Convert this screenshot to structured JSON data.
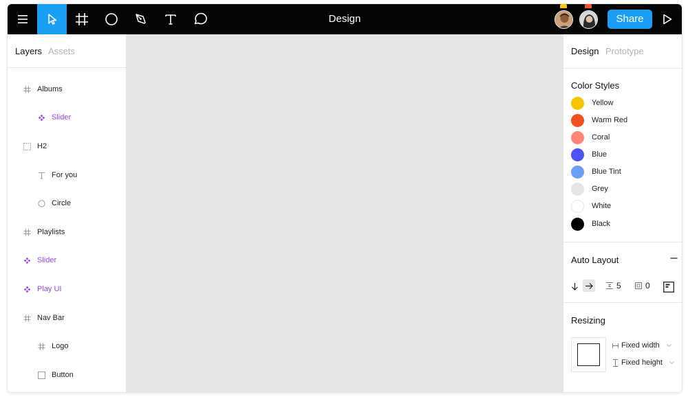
{
  "toolbar": {
    "title": "Design",
    "share_label": "Share",
    "tools": [
      {
        "name": "menu-icon"
      },
      {
        "name": "move-cursor-icon",
        "active": true
      },
      {
        "name": "frame-icon"
      },
      {
        "name": "ellipse-icon"
      },
      {
        "name": "pen-icon"
      },
      {
        "name": "text-icon"
      },
      {
        "name": "comment-icon"
      }
    ],
    "avatars": [
      {
        "name": "avatar-1",
        "dot_color": "#f5c518"
      },
      {
        "name": "avatar-2",
        "dot_color": "#f2542d"
      }
    ],
    "accent_color": "#1b9ef5"
  },
  "left_panel": {
    "tabs": [
      "Layers",
      "Assets"
    ],
    "active_tab": "Layers",
    "layers": [
      {
        "label": "Albums",
        "icon": "frame-icon",
        "indent": 0,
        "component": false
      },
      {
        "label": "Slider",
        "icon": "component-icon",
        "indent": 1,
        "component": true
      },
      {
        "label": "H2",
        "icon": "group-icon",
        "indent": 0,
        "component": false
      },
      {
        "label": "For you",
        "icon": "text-icon",
        "indent": 1,
        "component": false
      },
      {
        "label": "Circle",
        "icon": "ellipse-icon",
        "indent": 1,
        "component": false
      },
      {
        "label": "Playlists",
        "icon": "frame-icon",
        "indent": 0,
        "component": false
      },
      {
        "label": "Slider",
        "icon": "component-icon",
        "indent": 0,
        "component": true
      },
      {
        "label": "Play UI",
        "icon": "component-icon",
        "indent": 0,
        "component": true
      },
      {
        "label": "Nav Bar",
        "icon": "frame-icon",
        "indent": 0,
        "component": false
      },
      {
        "label": "Logo",
        "icon": "frame-icon",
        "indent": 1,
        "component": false
      },
      {
        "label": "Button",
        "icon": "rectangle-icon",
        "indent": 1,
        "component": false
      }
    ]
  },
  "right_panel": {
    "tabs": [
      "Design",
      "Prototype"
    ],
    "active_tab": "Design",
    "color_styles": {
      "title": "Color Styles",
      "items": [
        {
          "label": "Yellow",
          "color": "#f7c600"
        },
        {
          "label": "Warm Red",
          "color": "#f24e1e"
        },
        {
          "label": "Coral",
          "color": "#ff8577"
        },
        {
          "label": "Blue",
          "color": "#4f52f2"
        },
        {
          "label": "Blue Tint",
          "color": "#6a9ff5"
        },
        {
          "label": "Grey",
          "color": "#e5e5e5"
        },
        {
          "label": "White",
          "color": "#ffffff"
        },
        {
          "label": "Black",
          "color": "#000000"
        }
      ]
    },
    "auto_layout": {
      "title": "Auto Layout",
      "spacing": "5",
      "padding": "0"
    },
    "resizing": {
      "title": "Resizing",
      "width_label": "Fixed width",
      "height_label": "Fixed height"
    }
  }
}
